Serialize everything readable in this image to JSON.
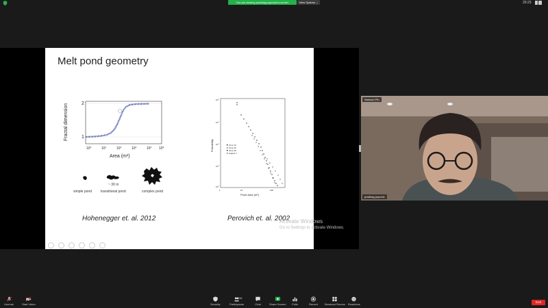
{
  "topbar": {
    "share_banner": "You are viewing pradhag popovich's screen",
    "view_options": "View Options ⌄",
    "clock": "20:23"
  },
  "slide": {
    "title": "Melt pond geometry",
    "caption_left": "Hohenegger et. al. 2012",
    "caption_right": "Perovich et. al. 2002",
    "fractal_chart": {
      "ylabel": "Fractal dimension",
      "xlabel": "Area (m²)",
      "ytick_1": "1",
      "ytick_2": "2"
    },
    "ponds": {
      "simple": "simple pond",
      "transitional": "transitional pond",
      "complex": "complex pond",
      "scale": "~ 30 m"
    },
    "prob_chart": {
      "ylabel": "Probability",
      "xlabel": "Pond area (m²)",
      "legend": [
        "June 12",
        "June 22",
        "June 30",
        "August 7"
      ]
    }
  },
  "watermark": {
    "line1": "Activate Windows",
    "line2": "Go to Settings to activate Windows."
  },
  "video": {
    "name_top": "Samson Pin",
    "name_bottom": "pradhag popovic"
  },
  "toolbar": {
    "unmute": "Unmute",
    "start_video": "Start Video",
    "security": "Security",
    "participants": "Participants",
    "participants_count": "38",
    "chat": "Chat",
    "share_screen": "Share Screen",
    "polls": "Polls",
    "record": "Record",
    "breakout": "Breakout Rooms",
    "reactions": "Reactions",
    "end": "End"
  }
}
